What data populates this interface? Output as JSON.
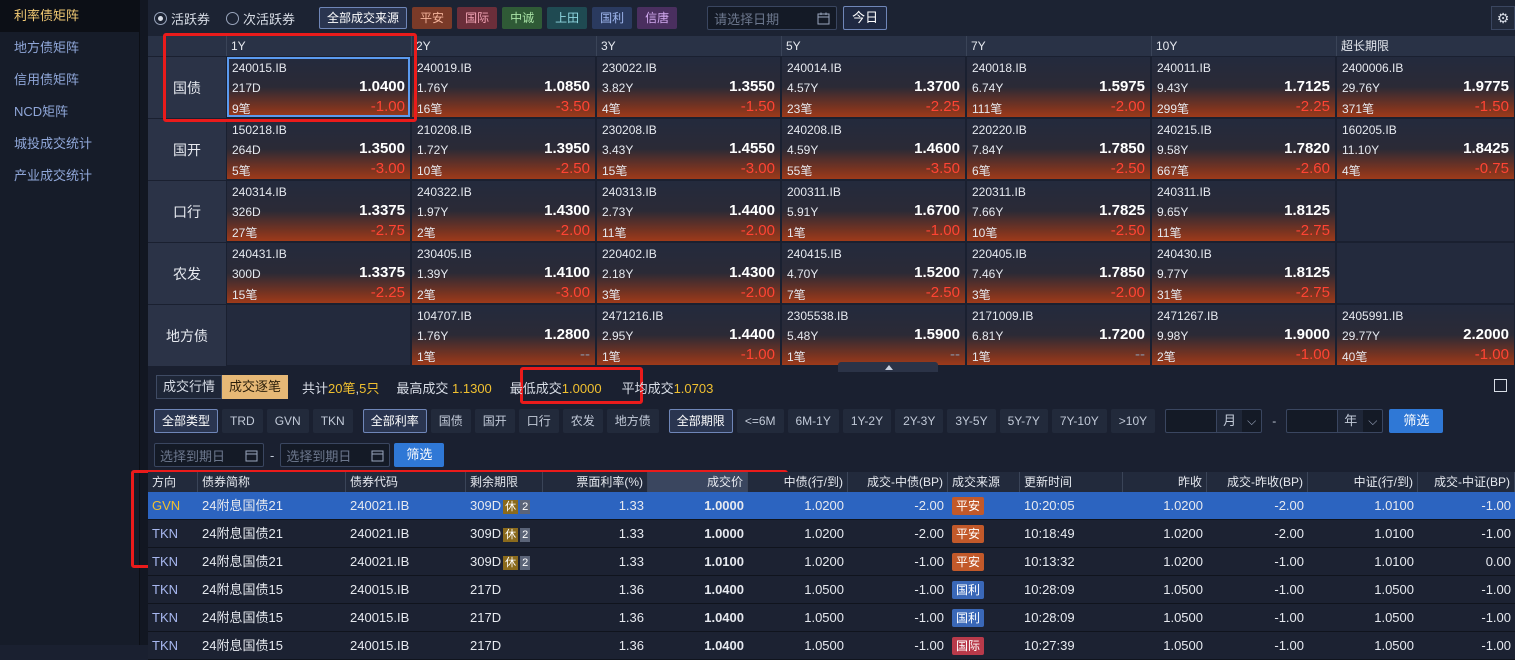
{
  "sidebar": {
    "items": [
      {
        "label": "利率债矩阵",
        "active": true
      },
      {
        "label": "地方债矩阵",
        "active": false
      },
      {
        "label": "信用债矩阵",
        "active": false
      },
      {
        "label": "NCD矩阵",
        "active": false
      },
      {
        "label": "城投成交统计",
        "active": false
      },
      {
        "label": "产业成交统计",
        "active": false
      }
    ]
  },
  "topbar": {
    "radio_active": "活跃券",
    "radio_inactive": "次活跃券",
    "sources": [
      {
        "label": "全部成交来源",
        "color": "#2a3550",
        "text": "#ffffff"
      },
      {
        "label": "平安",
        "color": "#7a3a28",
        "text": "#f4b39a"
      },
      {
        "label": "国际",
        "color": "#6b2e3a",
        "text": "#f2a3b4"
      },
      {
        "label": "中诚",
        "color": "#2f5a36",
        "text": "#a8e2a5"
      },
      {
        "label": "上田",
        "color": "#1f4a52",
        "text": "#8fd7e0"
      },
      {
        "label": "国利",
        "color": "#2a3a5f",
        "text": "#9fb7ef"
      },
      {
        "label": "信唐",
        "color": "#4a2f5f",
        "text": "#d1a9ef"
      }
    ],
    "date_placeholder": "请选择日期",
    "today_label": "今日"
  },
  "matrix": {
    "columns": [
      "1Y",
      "2Y",
      "3Y",
      "5Y",
      "7Y",
      "10Y",
      "超长期限"
    ],
    "rows": [
      {
        "label": "国债",
        "cells": [
          {
            "code": "240015.IB",
            "term": "217D",
            "count": "9笔",
            "price": "1.0400",
            "chg": "-1.00"
          },
          {
            "code": "240019.IB",
            "term": "1.76Y",
            "count": "16笔",
            "price": "1.0850",
            "chg": "-3.50"
          },
          {
            "code": "230022.IB",
            "term": "3.82Y",
            "count": "4笔",
            "price": "1.3550",
            "chg": "-1.50"
          },
          {
            "code": "240014.IB",
            "term": "4.57Y",
            "count": "23笔",
            "price": "1.3700",
            "chg": "-2.25"
          },
          {
            "code": "240018.IB",
            "term": "6.74Y",
            "count": "111笔",
            "price": "1.5975",
            "chg": "-2.00"
          },
          {
            "code": "240011.IB",
            "term": "9.43Y",
            "count": "299笔",
            "price": "1.7125",
            "chg": "-2.25"
          },
          {
            "code": "2400006.IB",
            "term": "29.76Y",
            "count": "371笔",
            "price": "1.9775",
            "chg": "-1.50"
          }
        ]
      },
      {
        "label": "国开",
        "cells": [
          {
            "code": "150218.IB",
            "term": "264D",
            "count": "5笔",
            "price": "1.3500",
            "chg": "-3.00"
          },
          {
            "code": "210208.IB",
            "term": "1.72Y",
            "count": "10笔",
            "price": "1.3950",
            "chg": "-2.50"
          },
          {
            "code": "230208.IB",
            "term": "3.43Y",
            "count": "15笔",
            "price": "1.4550",
            "chg": "-3.00"
          },
          {
            "code": "240208.IB",
            "term": "4.59Y",
            "count": "55笔",
            "price": "1.4600",
            "chg": "-3.50"
          },
          {
            "code": "220220.IB",
            "term": "7.84Y",
            "count": "6笔",
            "price": "1.7850",
            "chg": "-2.50"
          },
          {
            "code": "240215.IB",
            "term": "9.58Y",
            "count": "667笔",
            "price": "1.7820",
            "chg": "-2.60"
          },
          {
            "code": "160205.IB",
            "term": "11.10Y",
            "count": "4笔",
            "price": "1.8425",
            "chg": "-0.75"
          }
        ]
      },
      {
        "label": "口行",
        "cells": [
          {
            "code": "240314.IB",
            "term": "326D",
            "count": "27笔",
            "price": "1.3375",
            "chg": "-2.75"
          },
          {
            "code": "240322.IB",
            "term": "1.97Y",
            "count": "2笔",
            "price": "1.4300",
            "chg": "-2.00"
          },
          {
            "code": "240313.IB",
            "term": "2.73Y",
            "count": "11笔",
            "price": "1.4400",
            "chg": "-2.00"
          },
          {
            "code": "200311.IB",
            "term": "5.91Y",
            "count": "1笔",
            "price": "1.6700",
            "chg": "-1.00"
          },
          {
            "code": "220311.IB",
            "term": "7.66Y",
            "count": "10笔",
            "price": "1.7825",
            "chg": "-2.50"
          },
          {
            "code": "240311.IB",
            "term": "9.65Y",
            "count": "11笔",
            "price": "1.8125",
            "chg": "-2.75"
          },
          null
        ]
      },
      {
        "label": "农发",
        "cells": [
          {
            "code": "240431.IB",
            "term": "300D",
            "count": "15笔",
            "price": "1.3375",
            "chg": "-2.25"
          },
          {
            "code": "230405.IB",
            "term": "1.39Y",
            "count": "2笔",
            "price": "1.4100",
            "chg": "-3.00"
          },
          {
            "code": "220402.IB",
            "term": "2.18Y",
            "count": "3笔",
            "price": "1.4300",
            "chg": "-2.00"
          },
          {
            "code": "240415.IB",
            "term": "4.70Y",
            "count": "7笔",
            "price": "1.5200",
            "chg": "-2.50"
          },
          {
            "code": "220405.IB",
            "term": "7.46Y",
            "count": "3笔",
            "price": "1.7850",
            "chg": "-2.00"
          },
          {
            "code": "240430.IB",
            "term": "9.77Y",
            "count": "31笔",
            "price": "1.8125",
            "chg": "-2.75"
          },
          null
        ]
      },
      {
        "label": "地方债",
        "cells": [
          null,
          {
            "code": "104707.IB",
            "term": "1.76Y",
            "count": "1笔",
            "price": "1.2800",
            "chg": "--"
          },
          {
            "code": "2471216.IB",
            "term": "2.95Y",
            "count": "1笔",
            "price": "1.4400",
            "chg": "-1.00"
          },
          {
            "code": "2305538.IB",
            "term": "5.48Y",
            "count": "1笔",
            "price": "1.5900",
            "chg": "--"
          },
          {
            "code": "2171009.IB",
            "term": "6.81Y",
            "count": "1笔",
            "price": "1.7200",
            "chg": "--"
          },
          {
            "code": "2471267.IB",
            "term": "9.98Y",
            "count": "2笔",
            "price": "1.9000",
            "chg": "-1.00"
          },
          {
            "code": "2405991.IB",
            "term": "29.77Y",
            "count": "40笔",
            "price": "2.2000",
            "chg": "-1.00"
          }
        ]
      }
    ]
  },
  "summary": {
    "tab1": "成交行情",
    "tab2": "成交逐笔",
    "total_prefix": "共计",
    "total_trades": "20笔",
    "total_sep": ",",
    "total_bonds": "5只",
    "max_label": "最高成交",
    "max_value": "1.1300",
    "min_label": "最低成交",
    "min_value": "1.0000",
    "avg_label": "平均成交",
    "avg_value": "1.0703"
  },
  "filters": {
    "types": [
      "全部类型",
      "TRD",
      "GVN",
      "TKN"
    ],
    "rates": [
      "全部利率",
      "国债",
      "国开",
      "口行",
      "农发",
      "地方债"
    ],
    "terms": [
      "全部期限",
      "<=6M",
      "6M-1Y",
      "1Y-2Y",
      "2Y-3Y",
      "3Y-5Y",
      "5Y-7Y",
      "7Y-10Y",
      ">10Y"
    ],
    "month_label": "月",
    "year_label": "年",
    "dash": "-",
    "filter_btn": "筛选",
    "date_from_placeholder": "选择到期日",
    "date_to_placeholder": "选择到期日"
  },
  "table": {
    "headers": [
      "方向",
      "债券简称",
      "债券代码",
      "剩余期限",
      "票面利率(%)",
      "成交价",
      "中债(行/到)",
      "成交-中债(BP)",
      "成交来源",
      "更新时间",
      "昨收",
      "成交-昨收(BP)",
      "中证(行/到)",
      "成交-中证(BP)"
    ],
    "rows": [
      {
        "dir": "GVN",
        "name": "24附息国债21",
        "code": "240021.IB",
        "term": "309D",
        "hol": "休",
        "hol_n": "2",
        "coupon": "1.33",
        "price": "1.0000",
        "cb": "1.0200",
        "dcb": "-2.00",
        "src": "平安",
        "src_color": "#c2592a",
        "time": "10:20:05",
        "prev": "1.0200",
        "dprev": "-2.00",
        "cs": "1.0100",
        "dcs": "-1.00"
      },
      {
        "dir": "TKN",
        "name": "24附息国债21",
        "code": "240021.IB",
        "term": "309D",
        "hol": "休",
        "hol_n": "2",
        "coupon": "1.33",
        "price": "1.0000",
        "cb": "1.0200",
        "dcb": "-2.00",
        "src": "平安",
        "src_color": "#c2592a",
        "time": "10:18:49",
        "prev": "1.0200",
        "dprev": "-2.00",
        "cs": "1.0100",
        "dcs": "-1.00"
      },
      {
        "dir": "TKN",
        "name": "24附息国债21",
        "code": "240021.IB",
        "term": "309D",
        "hol": "休",
        "hol_n": "2",
        "coupon": "1.33",
        "price": "1.0100",
        "cb": "1.0200",
        "dcb": "-1.00",
        "src": "平安",
        "src_color": "#c2592a",
        "time": "10:13:32",
        "prev": "1.0200",
        "dprev": "-1.00",
        "cs": "1.0100",
        "dcs": "0.00"
      },
      {
        "dir": "TKN",
        "name": "24附息国债15",
        "code": "240015.IB",
        "term": "217D",
        "hol": "",
        "hol_n": "",
        "coupon": "1.36",
        "price": "1.0400",
        "cb": "1.0500",
        "dcb": "-1.00",
        "src": "国利",
        "src_color": "#3a68b8",
        "time": "10:28:09",
        "prev": "1.0500",
        "dprev": "-1.00",
        "cs": "1.0500",
        "dcs": "-1.00"
      },
      {
        "dir": "TKN",
        "name": "24附息国债15",
        "code": "240015.IB",
        "term": "217D",
        "hol": "",
        "hol_n": "",
        "coupon": "1.36",
        "price": "1.0400",
        "cb": "1.0500",
        "dcb": "-1.00",
        "src": "国利",
        "src_color": "#3a68b8",
        "time": "10:28:09",
        "prev": "1.0500",
        "dprev": "-1.00",
        "cs": "1.0500",
        "dcs": "-1.00"
      },
      {
        "dir": "TKN",
        "name": "24附息国债15",
        "code": "240015.IB",
        "term": "217D",
        "hol": "",
        "hol_n": "",
        "coupon": "1.36",
        "price": "1.0400",
        "cb": "1.0500",
        "dcb": "-1.00",
        "src": "国际",
        "src_color": "#b83a4a",
        "time": "10:27:39",
        "prev": "1.0500",
        "dprev": "-1.00",
        "cs": "1.0500",
        "dcs": "-1.00"
      }
    ]
  }
}
